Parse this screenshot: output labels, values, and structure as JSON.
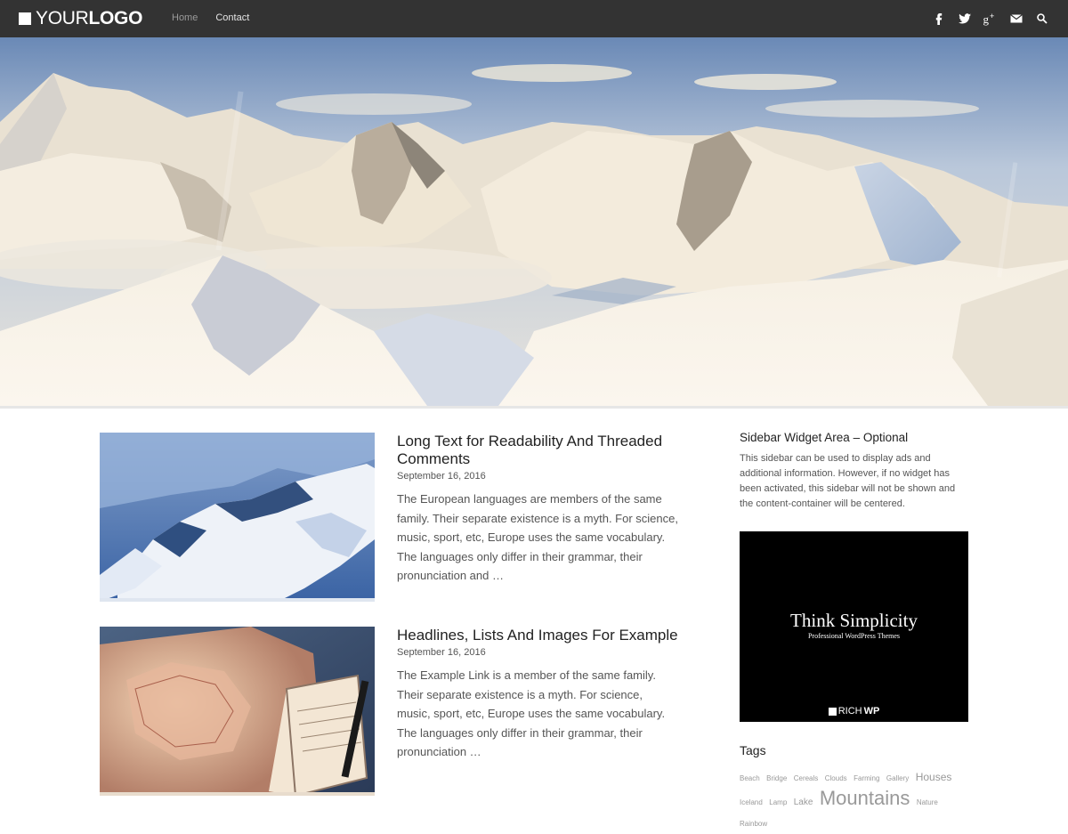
{
  "header": {
    "logo": {
      "light": "YOUR",
      "bold": "LOGO"
    },
    "nav": [
      {
        "label": "Home"
      },
      {
        "label": "Contact"
      }
    ],
    "social_icons": [
      "facebook-icon",
      "twitter-icon",
      "google-plus-icon",
      "email-icon",
      "search-icon"
    ]
  },
  "hero": {
    "image": "snowy-mountain-range-aerial"
  },
  "posts": [
    {
      "title": "Long Text for Readability And Threaded Comments",
      "date": "September 16, 2016",
      "excerpt": "The European languages are members of the same family. Their separate existence is a myth. For science, music, sport, etc, Europe uses the same vocabulary. The languages only differ in their grammar, their pronunciation and …",
      "thumbnail": "snowy-ridge"
    },
    {
      "title": "Headlines, Lists And Images For Example",
      "date": "September 16, 2016",
      "excerpt": "The Example Link is a member of the same family. Their separate existence is a myth. For science, music, sport, etc, Europe uses the same vocabulary. The languages only differ in their grammar, their pronunciation …",
      "thumbnail": "map-notebook-pen"
    }
  ],
  "sidebar": {
    "widget_title": "Sidebar Widget Area – Optional",
    "widget_text": "This sidebar can be used to display ads and additional information. However, if no widget has been activated, this sidebar will not be shown and the content-container will be centered.",
    "ad": {
      "title": "Think Simplicity",
      "subtitle": "Professional WordPress Themes",
      "brand_light": "RICH",
      "brand_bold": "WP"
    },
    "tags_title": "Tags",
    "tags": [
      {
        "label": "Beach",
        "weight": 8
      },
      {
        "label": "Bridge",
        "weight": 8
      },
      {
        "label": "Cereals",
        "weight": 8
      },
      {
        "label": "Clouds",
        "weight": 8
      },
      {
        "label": "Farming",
        "weight": 8
      },
      {
        "label": "Gallery",
        "weight": 8
      },
      {
        "label": "Houses",
        "weight": 12
      },
      {
        "label": "Iceland",
        "weight": 8
      },
      {
        "label": "Lamp",
        "weight": 8
      },
      {
        "label": "Lake",
        "weight": 10
      },
      {
        "label": "Mountains",
        "weight": 22
      },
      {
        "label": "Nature",
        "weight": 8
      },
      {
        "label": "Rainbow",
        "weight": 8
      }
    ]
  }
}
